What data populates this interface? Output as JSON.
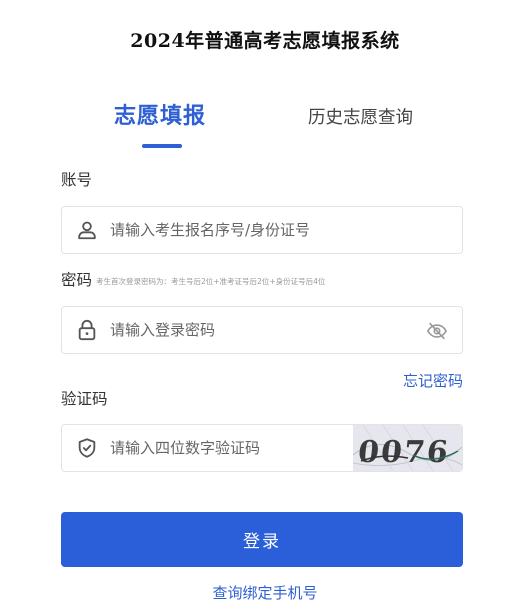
{
  "page_title": "2024年普通高考志愿填报系统",
  "tabs": {
    "active": "志愿填报",
    "history": "历史志愿查询"
  },
  "account": {
    "label": "账号",
    "placeholder": "请输入考生报名序号/身份证号",
    "icon": "user-icon"
  },
  "password": {
    "label": "密码",
    "hint": "考生首次登录密码为：考生号后2位+准考证号后2位+身份证号后4位",
    "placeholder": "请输入登录密码",
    "icon": "lock-icon",
    "toggle_icon": "eye-off-icon"
  },
  "forgot_password": "忘记密码",
  "captcha": {
    "label": "验证码",
    "placeholder": "请输入四位数字验证码",
    "icon": "shield-icon",
    "image_text": "0076"
  },
  "login_button": "登录",
  "bind_phone_link": "查询绑定手机号",
  "colors": {
    "accent": "#2e5fd3",
    "button": "#2b5fd9"
  }
}
